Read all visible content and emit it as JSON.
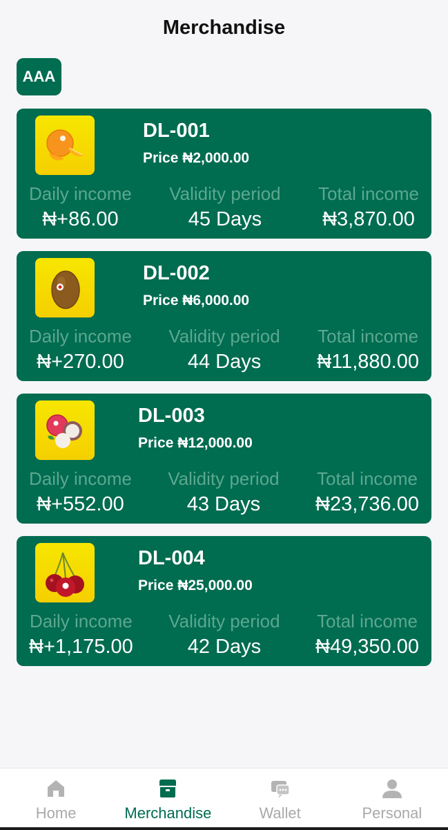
{
  "header": {
    "title": "Merchandise"
  },
  "filter": {
    "label": "AAA"
  },
  "labels": {
    "daily_income": "Daily income",
    "validity_period": "Validity period",
    "total_income": "Total income"
  },
  "products": [
    {
      "name": "DL-001",
      "price": "Price ₦2,000.00",
      "daily_income": "₦+86.00",
      "validity": "45 Days",
      "total_income": "₦3,870.00",
      "image": "orange-fruit-image"
    },
    {
      "name": "DL-002",
      "price": "Price ₦6,000.00",
      "daily_income": "₦+270.00",
      "validity": "44 Days",
      "total_income": "₦11,880.00",
      "image": "kiwi-fruit-image"
    },
    {
      "name": "DL-003",
      "price": "Price ₦12,000.00",
      "daily_income": "₦+552.00",
      "validity": "43 Days",
      "total_income": "₦23,736.00",
      "image": "lychee-fruit-image"
    },
    {
      "name": "DL-004",
      "price": "Price ₦25,000.00",
      "daily_income": "₦+1,175.00",
      "validity": "42 Days",
      "total_income": "₦49,350.00",
      "image": "cherry-fruit-image"
    }
  ],
  "nav": {
    "items": [
      {
        "label": "Home",
        "icon": "home-icon",
        "active": false
      },
      {
        "label": "Merchandise",
        "icon": "store-icon",
        "active": true
      },
      {
        "label": "Wallet",
        "icon": "wallet-icon",
        "active": false
      },
      {
        "label": "Personal",
        "icon": "person-icon",
        "active": false
      }
    ]
  },
  "colors": {
    "brand": "#006c50",
    "stat_label": "#5ba88f",
    "nav_inactive": "#a9a9a9",
    "thumb_bg": "#f5d800"
  }
}
